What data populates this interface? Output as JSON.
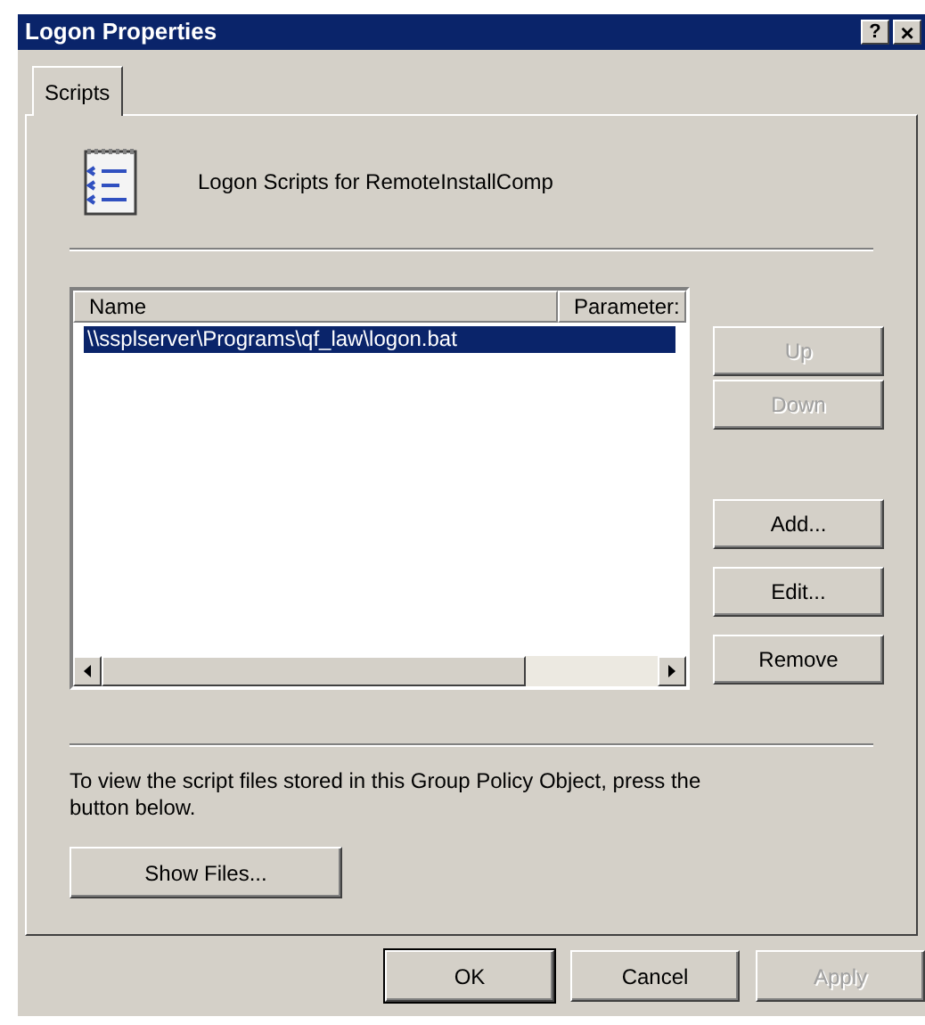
{
  "window": {
    "title": "Logon Properties",
    "help_button": "?",
    "close_button": "×"
  },
  "tabs": [
    {
      "label": "Scripts",
      "selected": true
    }
  ],
  "heading": "Logon Scripts for RemoteInstallComp",
  "list": {
    "columns": [
      "Name",
      "Parameter:"
    ],
    "rows": [
      {
        "name": "\\\\ssplserver\\Programs\\qf_law\\logon.bat",
        "selected": true
      }
    ]
  },
  "side_buttons": [
    {
      "label": "Up",
      "disabled": true
    },
    {
      "label": "Down",
      "disabled": true
    },
    {
      "label": "Add...",
      "disabled": false
    },
    {
      "label": "Edit...",
      "disabled": false
    },
    {
      "label": "Remove",
      "disabled": false
    }
  ],
  "info_text": "To view the script files stored in this Group Policy Object, press the button below.",
  "show_files_button": {
    "label": "Show Files..."
  },
  "dialog_buttons": [
    {
      "label": "OK",
      "default": true,
      "disabled": false
    },
    {
      "label": "Cancel",
      "default": false,
      "disabled": false
    },
    {
      "label": "Apply",
      "default": false,
      "disabled": true
    }
  ]
}
